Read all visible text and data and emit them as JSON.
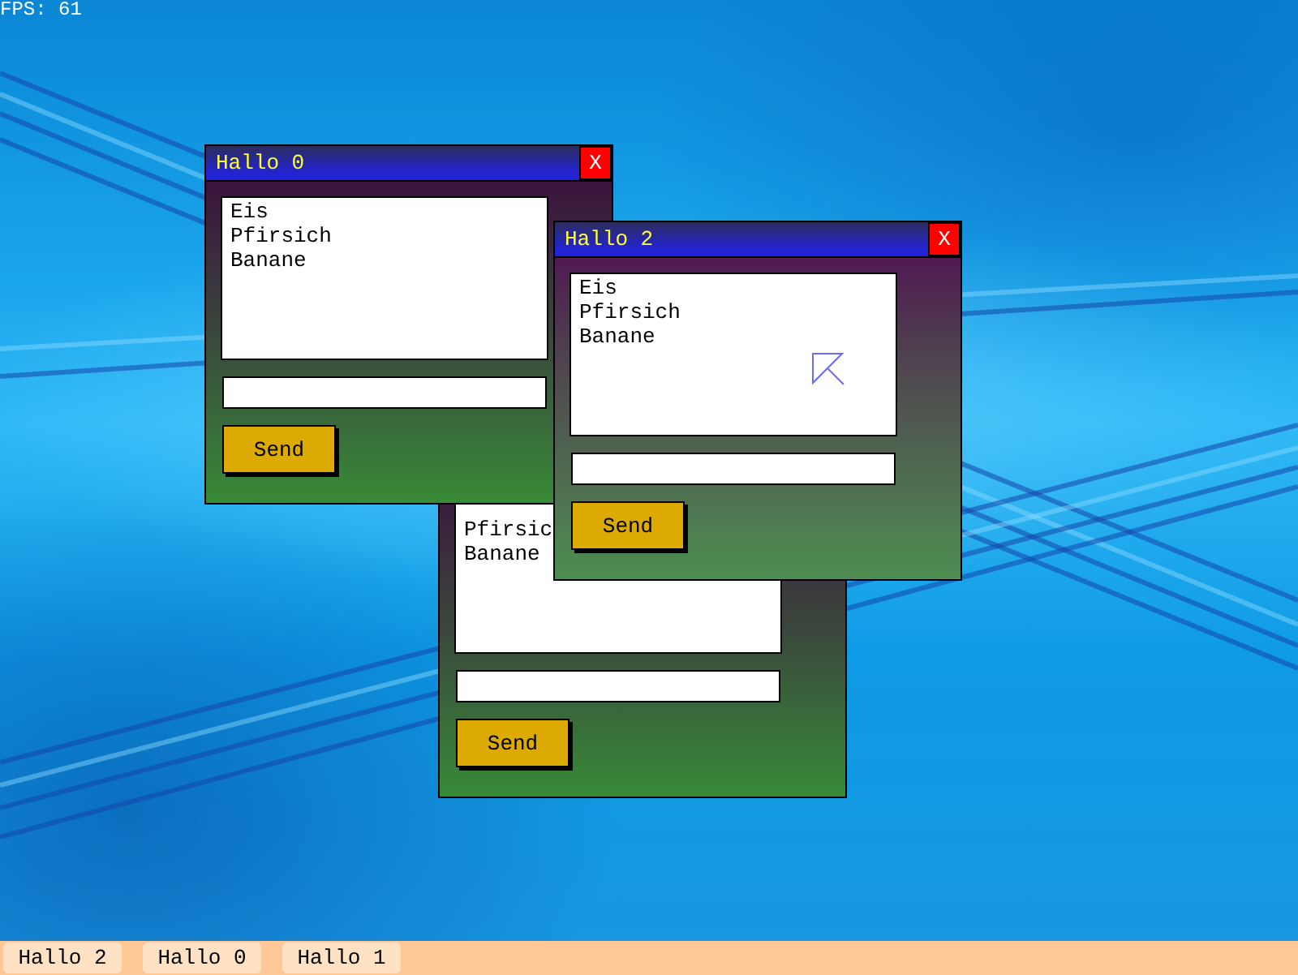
{
  "fps_counter": "FPS: 61",
  "windows": [
    {
      "title": "Hallo 2",
      "close_label": "X",
      "active": true,
      "list_items": [
        "Eis",
        "Pfirsich",
        "Banane"
      ],
      "button": "Send"
    },
    {
      "title": "Hallo 0",
      "close_label": "X",
      "active": false,
      "list_items": [
        "Eis",
        "Pfirsich",
        "Banane"
      ],
      "button": "Send"
    },
    {
      "active": false,
      "list_items": [
        "Pfirsic",
        "Banane"
      ],
      "button": "Send"
    }
  ],
  "taskbar": {
    "buttons": [
      "Hallo 2",
      "Hallo 0",
      "Hallo 1"
    ]
  }
}
